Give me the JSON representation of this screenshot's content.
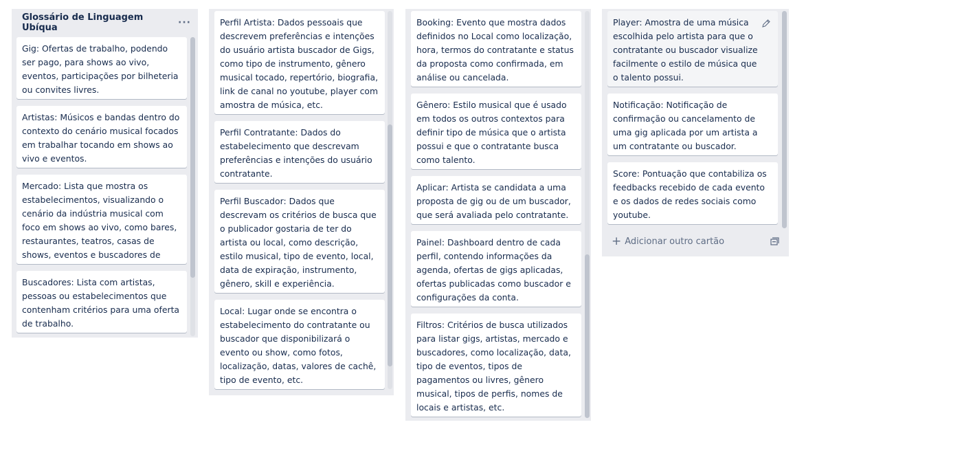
{
  "list1": {
    "title": "Glossário de Linguagem Ubíqua",
    "menu_icon": "ellipsis-icon",
    "cards": [
      "Gig: Ofertas de trabalho, podendo ser pago, para shows ao vivo, eventos, participações por bilheteria ou convites livres.",
      "Artistas: Músicos e bandas dentro do contexto do cenário musical focados em trabalhar tocando em shows ao vivo e eventos.",
      "Mercado: Lista que mostra os estabelecimentos, visualizando o cenário da indústria musical com foco em shows ao vivo, como bares, restaurantes, teatros, casas de shows, eventos e buscadores de talentos.",
      "Buscadores: Lista com artistas, pessoas ou estabelecimentos que contenham critérios para uma oferta de trabalho."
    ]
  },
  "list2": {
    "cards": [
      "Perfil Artista: Dados pessoais que descrevem preferências e intenções do usuário artista buscador de Gigs, como tipo de instrumento, gênero musical tocado, repertório, biografia, link de canal no youtube, player com amostra de música, etc.",
      "Perfil Contratante: Dados do estabelecimento que descrevam preferências e intenções do usuário contratante.",
      "Perfil Buscador: Dados que descrevam os critérios de busca que o publicador gostaria de ter do artista ou local, como descrição, estilo musical, tipo de evento, local, data de expiração, instrumento, gênero, skill e experiência.",
      "Local: Lugar onde se encontra o estabelecimento do contratante ou buscador que disponibilizará o evento ou show, como fotos, localização, datas, valores de cachê, tipo de evento, etc."
    ]
  },
  "list3": {
    "cards": [
      "Booking: Evento que mostra dados definidos no Local como localização, hora, termos do contratante e status da proposta como confirmada, em análise ou cancelada.",
      "Gênero: Estilo musical que é usado em todos os outros contextos para definir tipo de música que o artista possui e que o contratante busca como talento.",
      "Aplicar: Artista se candidata a uma proposta de gig ou de um buscador, que será avaliada pelo contratante.",
      "Painel: Dashboard dentro de cada perfil, contendo informações da agenda, ofertas de gigs aplicadas, ofertas publicadas como buscador e configurações da conta.",
      "Filtros: Critérios de busca utilizados para listar gigs, artistas, mercado e buscadores, como localização, data, tipo de eventos, tipos de pagamentos ou livres, gênero musical, tipos de perfis, nomes de locais e artistas, etc."
    ]
  },
  "list4": {
    "cards": [
      "Player: Amostra de uma música escolhida pelo artista para que o contratante ou buscador visualize facilmente o estilo de música que o talento possui.",
      "Notificação: Notificação de confirmação ou cancelamento de uma gig aplicada por um artista a um contratante ou buscador.",
      "Score: Pontuação que contabiliza os feedbacks recebido de cada evento e os dados de redes sociais como youtube."
    ],
    "add_card_label": "Adicionar outro cartão",
    "edit_icon": "pencil-icon",
    "template_icon": "card-template-icon"
  }
}
